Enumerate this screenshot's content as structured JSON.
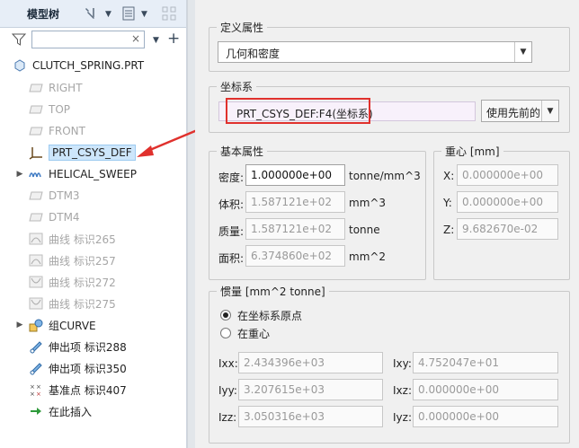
{
  "tree": {
    "title": "模型树",
    "root": "CLUTCH_SPRING.PRT",
    "items": [
      {
        "label": "RIGHT",
        "dim": true
      },
      {
        "label": "TOP",
        "dim": true
      },
      {
        "label": "FRONT",
        "dim": true
      },
      {
        "label": "PRT_CSYS_DEF",
        "selected": true
      },
      {
        "label": "HELICAL_SWEEP",
        "expandable": true
      },
      {
        "label": "DTM3",
        "dim": true
      },
      {
        "label": "DTM4",
        "dim": true
      },
      {
        "label": "曲线 标识265",
        "dim": true
      },
      {
        "label": "曲线 标识257",
        "dim": true
      },
      {
        "label": "曲线 标识272",
        "dim": true
      },
      {
        "label": "曲线 标识275",
        "dim": true
      },
      {
        "label": "组CURVE",
        "expandable": true
      },
      {
        "label": "伸出项 标识288"
      },
      {
        "label": "伸出项 标识350"
      },
      {
        "label": "基准点 标识407"
      },
      {
        "label": "在此插入"
      }
    ]
  },
  "define": {
    "legend": "定义属性",
    "value": "几何和密度"
  },
  "csys": {
    "legend": "坐标系",
    "value": "PRT_CSYS_DEF:F4(坐标系)",
    "button": "使用先前的"
  },
  "basic": {
    "legend": "基本属性",
    "density_label": "密度:",
    "density_value": "1.000000e+00",
    "density_unit": "tonne/mm^3",
    "volume_label": "体积:",
    "volume_value": "1.587121e+02",
    "volume_unit": "mm^3",
    "mass_label": "质量:",
    "mass_value": "1.587121e+02",
    "mass_unit": "tonne",
    "area_label": "面积:",
    "area_value": "6.374860e+02",
    "area_unit": "mm^2"
  },
  "cog": {
    "legend": "重心 [mm]",
    "x_label": "X:",
    "x_value": "0.000000e+00",
    "y_label": "Y:",
    "y_value": "0.000000e+00",
    "z_label": "Z:",
    "z_value": "9.682670e-02"
  },
  "inertia": {
    "legend": "惯量 [mm^2 tonne]",
    "radio1": "在坐标系原点",
    "radio2": "在重心",
    "ixx_label": "Ixx:",
    "ixx_value": "2.434396e+03",
    "ixy_label": "Ixy:",
    "ixy_value": "4.752047e+01",
    "iyy_label": "Iyy:",
    "iyy_value": "3.207615e+03",
    "ixz_label": "Ixz:",
    "ixz_value": "0.000000e+00",
    "izz_label": "Izz:",
    "izz_value": "3.050316e+03",
    "iyz_label": "Iyz:",
    "iyz_value": "0.000000e+00"
  },
  "colors": {
    "accent_red": "#e0312d",
    "selection": "#cde6fb"
  }
}
